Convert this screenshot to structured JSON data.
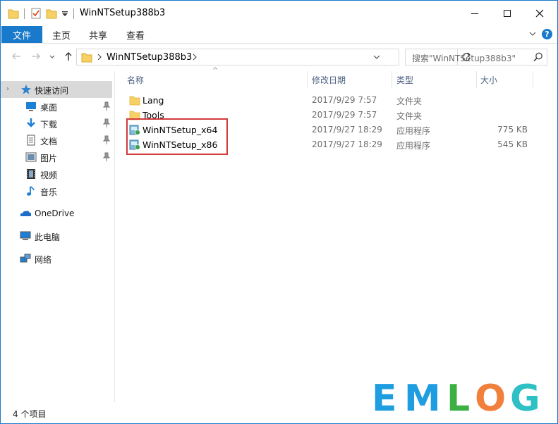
{
  "window": {
    "title": "WinNTSetup388b3",
    "controls": {
      "minimize": "—",
      "maximize": "☐",
      "close": "✕"
    }
  },
  "ribbon": {
    "tabs": [
      {
        "label": "文件",
        "active": true
      },
      {
        "label": "主页"
      },
      {
        "label": "共享"
      },
      {
        "label": "查看"
      }
    ],
    "help": "?"
  },
  "address": {
    "path": "WinNTSetup388b3",
    "search_placeholder": "搜索\"WinNTSetup388b3\""
  },
  "sidebar": {
    "quick_access": "快速访问",
    "items": [
      {
        "label": "桌面",
        "icon": "desktop-icon",
        "pinned": true
      },
      {
        "label": "下载",
        "icon": "download-icon",
        "pinned": true
      },
      {
        "label": "文档",
        "icon": "document-icon",
        "pinned": true
      },
      {
        "label": "图片",
        "icon": "picture-icon",
        "pinned": true
      },
      {
        "label": "视频",
        "icon": "video-icon",
        "pinned": false
      },
      {
        "label": "音乐",
        "icon": "music-icon",
        "pinned": false
      }
    ],
    "onedrive": "OneDrive",
    "this_pc": "此电脑",
    "network": "网络"
  },
  "list": {
    "columns": {
      "name": "名称",
      "date": "修改日期",
      "type": "类型",
      "size": "大小"
    },
    "rows": [
      {
        "name": "Lang",
        "date": "2017/9/29 7:57",
        "type": "文件夹",
        "size": "",
        "icon": "folder-icon"
      },
      {
        "name": "Tools",
        "date": "2017/9/29 7:57",
        "type": "文件夹",
        "size": "",
        "icon": "folder-icon"
      },
      {
        "name": "WinNTSetup_x64",
        "date": "2017/9/27 18:29",
        "type": "应用程序",
        "size": "775 KB",
        "icon": "setup-app-icon"
      },
      {
        "name": "WinNTSetup_x86",
        "date": "2017/9/27 18:29",
        "type": "应用程序",
        "size": "545 KB",
        "icon": "setup-app-icon"
      }
    ]
  },
  "status": {
    "count": "4 个项目"
  },
  "watermark": {
    "letters": [
      "E",
      "M",
      "L",
      "O",
      "G"
    ],
    "colors": [
      "#1e9de0",
      "#1e9de0",
      "#3cb043",
      "#f0803c",
      "#2ec0c4"
    ]
  },
  "colors": {
    "accent": "#1979ca",
    "folder": "#f7d165",
    "highlight": "#d23b3b"
  }
}
